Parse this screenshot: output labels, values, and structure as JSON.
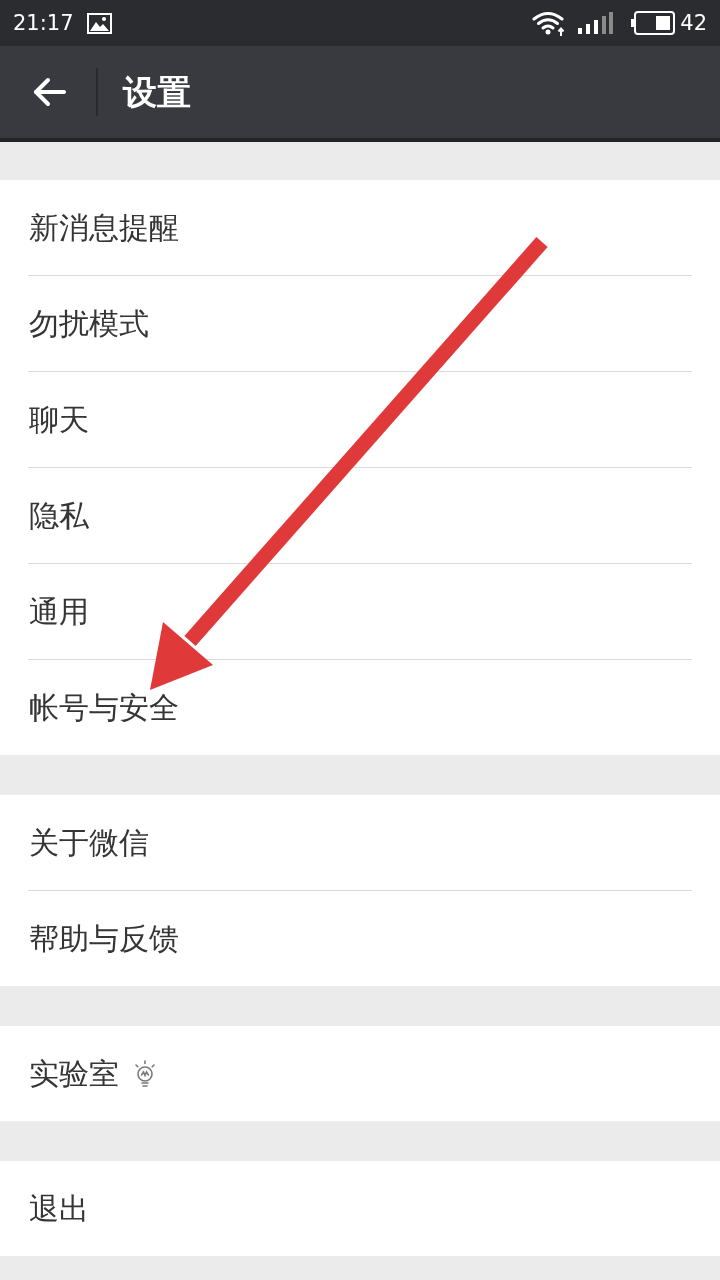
{
  "status_bar": {
    "time": "21:17",
    "battery": "42"
  },
  "header": {
    "title": "设置"
  },
  "groups": [
    {
      "items": [
        {
          "label": "新消息提醒",
          "kind": "plain"
        },
        {
          "label": "勿扰模式",
          "kind": "plain"
        },
        {
          "label": "聊天",
          "kind": "plain"
        },
        {
          "label": "隐私",
          "kind": "plain"
        },
        {
          "label": "通用",
          "kind": "plain"
        },
        {
          "label": "帐号与安全",
          "kind": "plain"
        }
      ]
    },
    {
      "items": [
        {
          "label": "关于微信",
          "kind": "plain"
        },
        {
          "label": "帮助与反馈",
          "kind": "plain"
        }
      ]
    },
    {
      "items": [
        {
          "label": "实验室",
          "kind": "badged"
        }
      ]
    },
    {
      "items": [
        {
          "label": "退出",
          "kind": "plain"
        }
      ]
    }
  ],
  "annotation": {
    "kind": "arrow"
  }
}
